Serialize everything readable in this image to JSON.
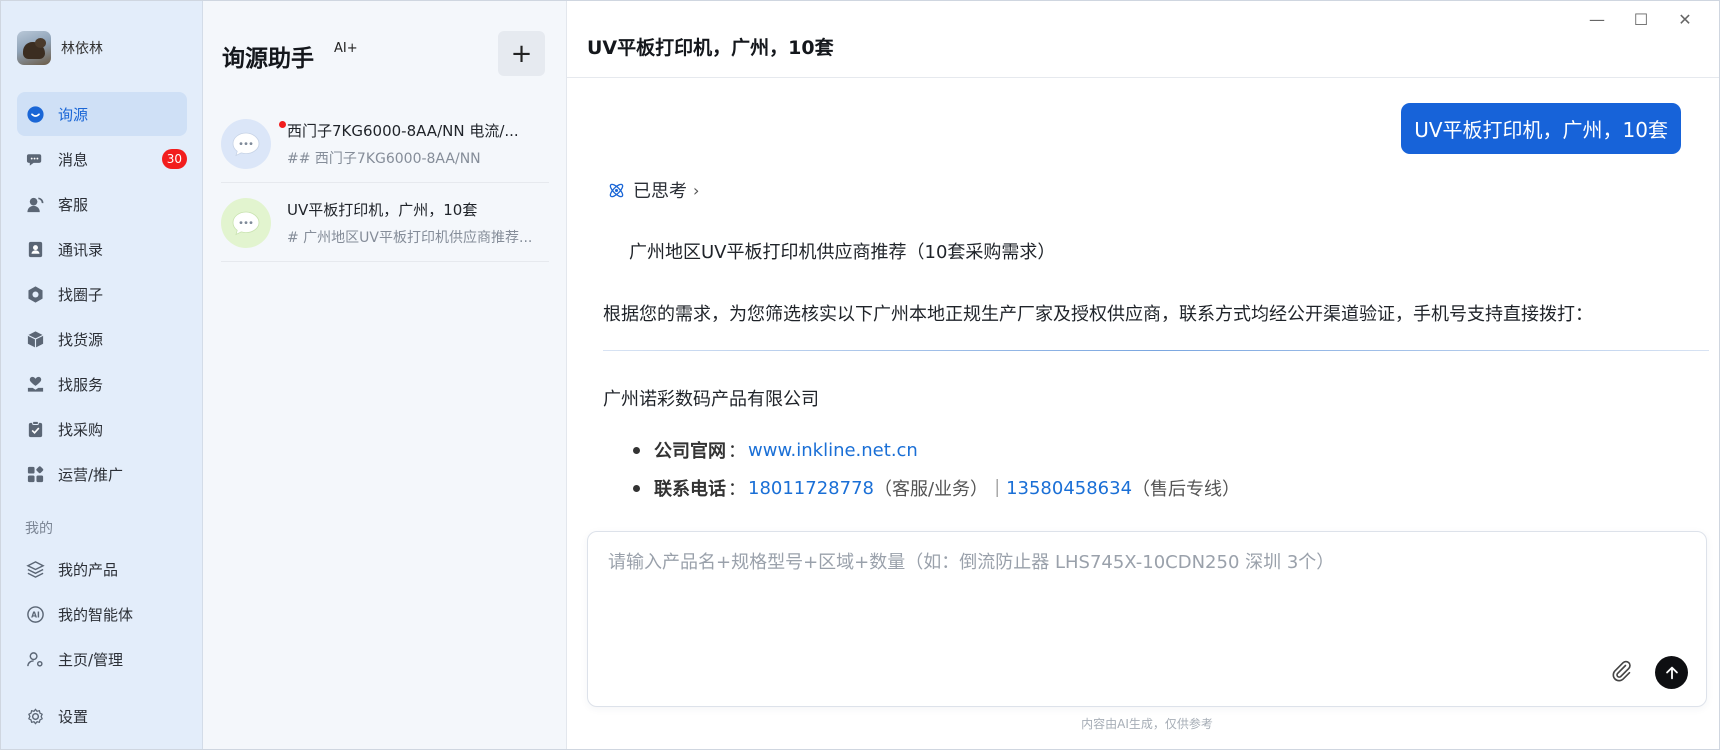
{
  "user": {
    "name": "林依林"
  },
  "nav": {
    "items": [
      {
        "key": "xunyuan",
        "label": "询源",
        "icon": "chat-bubble-icon",
        "active": true
      },
      {
        "key": "messages",
        "label": "消息",
        "icon": "message-icon",
        "badge": "30"
      },
      {
        "key": "service",
        "label": "客服",
        "icon": "customer-service-icon"
      },
      {
        "key": "contacts",
        "label": "通讯录",
        "icon": "contacts-icon"
      },
      {
        "key": "circle",
        "label": "找圈子",
        "icon": "hexagon-icon"
      },
      {
        "key": "goods",
        "label": "找货源",
        "icon": "box-icon"
      },
      {
        "key": "services",
        "label": "找服务",
        "icon": "heart-hand-icon"
      },
      {
        "key": "purchase",
        "label": "找采购",
        "icon": "clipboard-icon"
      },
      {
        "key": "ops",
        "label": "运营/推广",
        "icon": "grid-icon"
      }
    ],
    "mine_label": "我的",
    "mine_items": [
      {
        "key": "products",
        "label": "我的产品",
        "icon": "layers-icon"
      },
      {
        "key": "agents",
        "label": "我的智能体",
        "icon": "ai-icon"
      },
      {
        "key": "home",
        "label": "主页/管理",
        "icon": "user-gear-icon"
      }
    ],
    "settings_label": "设置"
  },
  "conversations": {
    "title": "询源助手",
    "tag": "AI+",
    "new_label": "+",
    "items": [
      {
        "title": "西门子7KG6000-8AA/NN 电流/...",
        "preview": "## 西门子7KG6000-8AA/NN",
        "unread": true
      },
      {
        "title": "UV平板打印机，广州，10套",
        "preview": "# 广州地区UV平板打印机供应商推荐..."
      }
    ]
  },
  "chat": {
    "title": "UV平板打印机，广州，10套",
    "user_message": "UV平板打印机，广州，10套",
    "thought_label": "已思考",
    "answer_heading": "广州地区UV平板打印机供应商推荐（10套采购需求）",
    "answer_intro": "根据您的需求，为您筛选核实以下广州本地正规生产厂家及授权供应商，联系方式均经公开渠道验证，手机号支持直接拨打：",
    "company": "广州诺彩数码产品有限公司",
    "website_label": "公司官网",
    "website": "www.inkline.net.cn",
    "phone_label": "联系电话",
    "phone1": "18011728778",
    "phone1_note": "（客服/业务）",
    "separator": "｜",
    "phone2": "13580458634",
    "phone2_note": "（售后专线）",
    "input_placeholder": "请输入产品名+规格型号+区域+数量（如：倒流防止器 LHS745X-10CDN250 深圳 3个）",
    "disclaimer": "内容由AI生成，仅供参考"
  },
  "window": {
    "minimize": "—",
    "maximize": "☐",
    "close": "✕"
  },
  "colors": {
    "accent": "#1763d9",
    "badge": "#f21d1d",
    "link": "#1a6fd6"
  }
}
